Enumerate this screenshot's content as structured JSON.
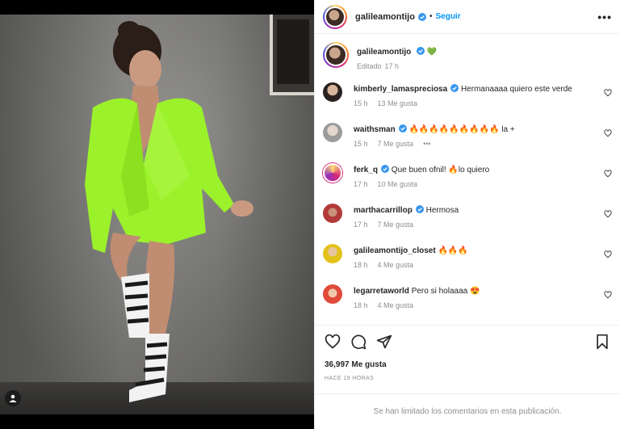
{
  "post": {
    "username": "galileamontijo",
    "follow_label": "Seguir",
    "separator": "•",
    "more_label": "•••"
  },
  "caption": {
    "username": "galileamontijo",
    "text": "💚",
    "meta_edited": "Editado",
    "meta_time": "17 h"
  },
  "comments": [
    {
      "username": "kimberly_lamaspreciosa",
      "verified": true,
      "text": "Hermanaaaa quiero este verde",
      "time": "15 h",
      "likes": "13 Me gusta",
      "extra": ""
    },
    {
      "username": "waithsman",
      "verified": true,
      "text": "🔥🔥🔥🔥🔥🔥🔥🔥🔥 la +",
      "time": "15 h",
      "likes": "7 Me gusta",
      "extra": "•••"
    },
    {
      "username": "ferk_q",
      "verified": true,
      "text": "Que buen ofnil! 🔥lo quiero",
      "time": "17 h",
      "likes": "10 Me gusta",
      "extra": ""
    },
    {
      "username": "marthacarrillop",
      "verified": true,
      "text": "Hermosa",
      "time": "17 h",
      "likes": "7 Me gusta",
      "extra": ""
    },
    {
      "username": "galileamontijo_closet",
      "verified": false,
      "text": "🔥🔥🔥",
      "time": "18 h",
      "likes": "4 Me gusta",
      "extra": ""
    },
    {
      "username": "legarretaworld",
      "verified": false,
      "text": "Pero si holaaaa 😍",
      "time": "18 h",
      "likes": "4 Me gusta",
      "extra": ""
    }
  ],
  "footer": {
    "likes_count": "36,997 Me gusta",
    "posted_ago": "HACE 19 HORAS",
    "comments_limited": "Se han limitado los comentarios en esta publicación."
  },
  "colors": {
    "accent_blue": "#0095f6",
    "verified_blue": "#3897f0",
    "muted_gray": "#8e8e8e",
    "blazer_green": "#9bf22a"
  },
  "icons": [
    "more-icon",
    "verified-icon",
    "heart-icon",
    "comment-icon",
    "share-icon",
    "save-icon",
    "user-tag-icon"
  ]
}
